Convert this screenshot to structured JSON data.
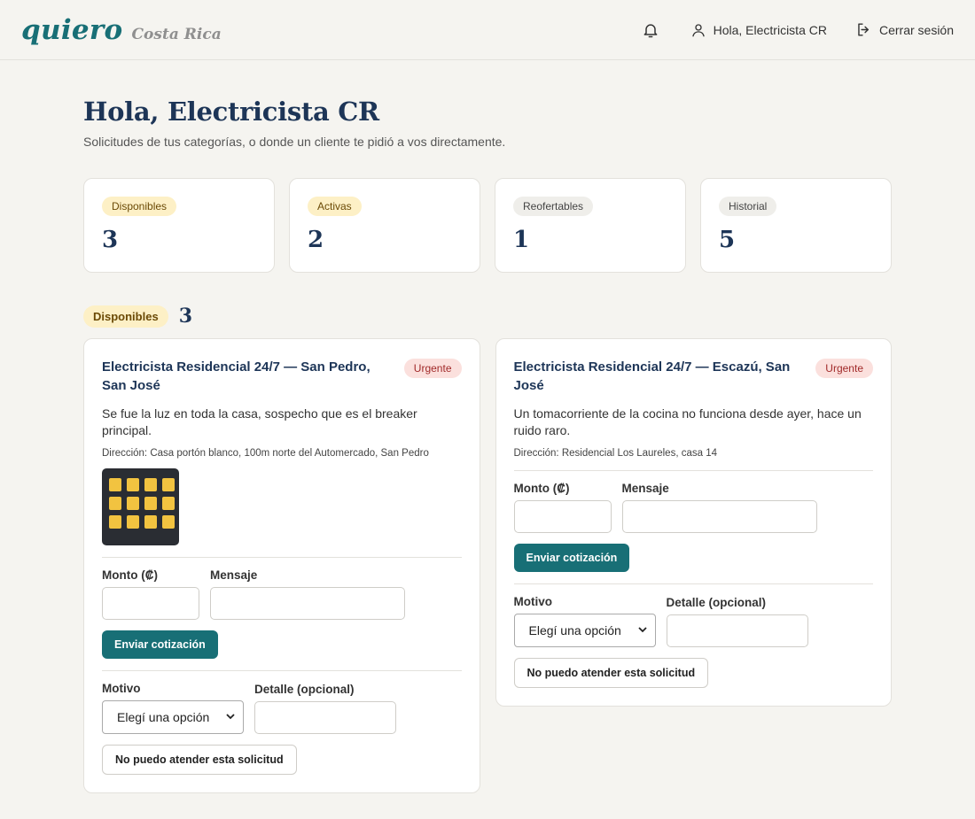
{
  "brand": {
    "name": "quiero",
    "region": "Costa Rica"
  },
  "nav": {
    "bell_icon": "bell-icon",
    "user_icon": "user-icon",
    "greeting": "Hola, Electricista CR",
    "logout_icon": "logout-icon",
    "logout": "Cerrar sesión"
  },
  "page": {
    "title": "Hola, Electricista CR",
    "subtitle": "Solicitudes de tus categorías, o donde un cliente te pidió a vos directamente."
  },
  "stats": [
    {
      "label": "Disponibles",
      "value": "3"
    },
    {
      "label": "Activas",
      "value": "2"
    },
    {
      "label": "Reofertables",
      "value": "1"
    },
    {
      "label": "Historial",
      "value": "5"
    }
  ],
  "section": {
    "label": "Disponibles",
    "count": "3"
  },
  "requests": [
    {
      "title": "Electricista Residencial 24/7 — San Pedro, San José",
      "badge": "Urgente",
      "description": "Se fue la luz en toda la casa, sospecho que es el breaker principal.",
      "address": "Dirección: Casa portón blanco, 100m norte del Automercado, San Pedro",
      "has_photo": true,
      "amount_label": "Monto (₡)",
      "message_label": "Mensaje",
      "submit_label": "Enviar cotización",
      "reason_label": "Motivo",
      "reason_value": "Elegí una opción",
      "detail_label": "Detalle (opcional)",
      "decline_label": "No puedo atender esta solicitud"
    },
    {
      "title": "Electricista Residencial 24/7 — Escazú, San José",
      "badge": "Urgente",
      "description": "Un tomacorriente de la cocina no funciona desde ayer, hace un ruido raro.",
      "address": "Dirección: Residencial Los Laureles, casa 14",
      "has_photo": false,
      "amount_label": "Monto (₡)",
      "message_label": "Mensaje",
      "submit_label": "Enviar cotización",
      "reason_label": "Motivo",
      "reason_value": "Elegí una opción",
      "detail_label": "Detalle (opcional)",
      "decline_label": "No puedo atender esta solicitud"
    }
  ]
}
